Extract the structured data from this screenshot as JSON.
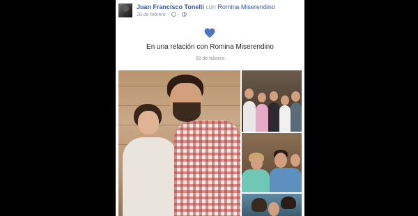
{
  "post": {
    "author": "Juan Francisco Tonelli",
    "with_word": "con",
    "tagged": "Romina Miserendino",
    "date": "28 de febrero",
    "sep": "·"
  },
  "life_event": {
    "title": "En una relación con Romina Miserendino",
    "date": "28 de febrero"
  },
  "icons": {
    "heart": "heart-icon",
    "clock": "clock-icon",
    "audience": "globe-icon"
  },
  "colors": {
    "link": "#3b5998",
    "heart": "#4a76c6",
    "meta": "#90949c",
    "background": "#000000"
  }
}
